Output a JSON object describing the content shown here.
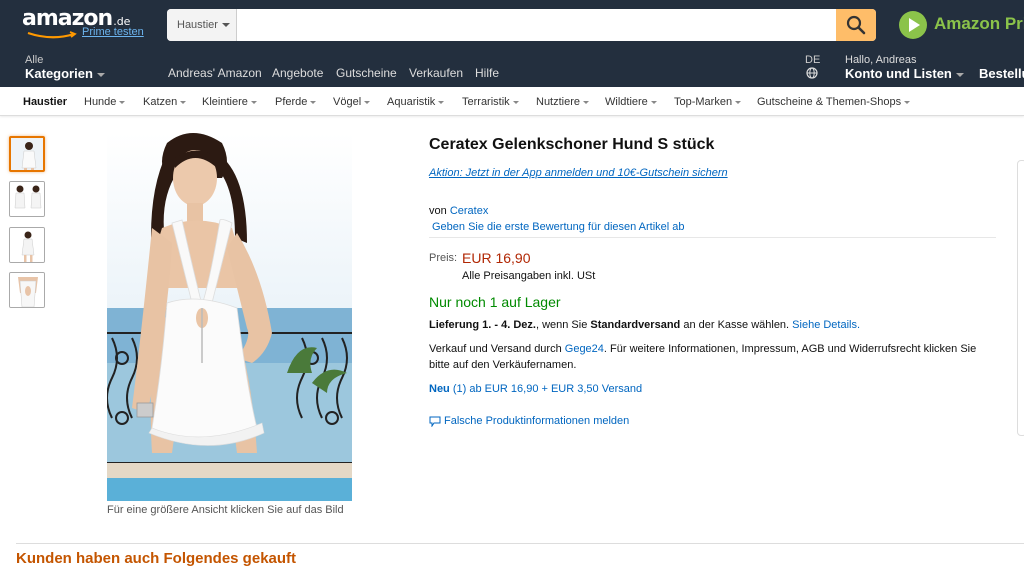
{
  "header": {
    "logo_text": "amazon",
    "logo_tld": ".de",
    "prime_link": "Prime testen",
    "search_category": "Haustier",
    "search_value": "",
    "search_placeholder": "",
    "prime_text": "Amazon Pri",
    "categories_small": "Alle",
    "categories_big": "Kategorien",
    "belt_links": [
      "Andreas' Amazon",
      "Angebote",
      "Gutscheine",
      "Verkaufen",
      "Hilfe"
    ],
    "language": "DE",
    "account_greeting": "Hallo, Andreas",
    "account_label": "Konto und Listen",
    "orders_label": "Bestellu"
  },
  "subnav": {
    "items": [
      "Haustier",
      "Hunde",
      "Katzen",
      "Kleintiere",
      "Pferde",
      "Vögel",
      "Aquaristik",
      "Terraristik",
      "Nutztiere",
      "Wildtiere",
      "Top-Marken",
      "Gutscheine & Themen-Shops"
    ]
  },
  "gallery": {
    "thumbnails": [
      "thumb-1",
      "thumb-2",
      "thumb-3",
      "thumb-4"
    ],
    "caption": "Für eine größere Ansicht klicken Sie auf das Bild"
  },
  "product": {
    "title": "Ceratex Gelenkschoner Hund S stück",
    "promo": "Aktion: Jetzt in der App anmelden und 10€-Gutschein sichern",
    "by_prefix": "von",
    "brand": "Ceratex",
    "review_link": "Geben Sie die erste Bewertung für diesen Artikel ab",
    "price_label": "Preis:",
    "price": "EUR 16,90",
    "vat_note": "Alle Preisangaben inkl. USt",
    "stock": "Nur noch 1 auf Lager",
    "delivery_prefix": "Lieferung 1. - 4. Dez.",
    "delivery_mid": ", wenn Sie ",
    "delivery_method": "Standardversand",
    "delivery_suffix": " an der Kasse wählen. ",
    "delivery_link": "Siehe Details.",
    "seller_prefix": "Verkauf und Versand durch ",
    "seller_name": "Gege24",
    "seller_suffix": ". Für weitere Informationen, Impressum, AGB und Widerrufsrecht klicken Sie bitte auf den Verkäufernamen.",
    "new_offer_bold": "Neu",
    "new_offer_text": " (1) ab EUR 16,90 + EUR 3,50 Versand",
    "report_link": "Falsche Produktinformationen melden"
  },
  "related": {
    "heading": "Kunden haben auch Folgendes gekauft"
  },
  "colors": {
    "nav_bg": "#232f3e",
    "search_button": "#febd69",
    "price": "#b12704",
    "stock": "#008a00",
    "link": "#0066c0",
    "heading": "#c45500",
    "prime": "#8bc34a"
  }
}
